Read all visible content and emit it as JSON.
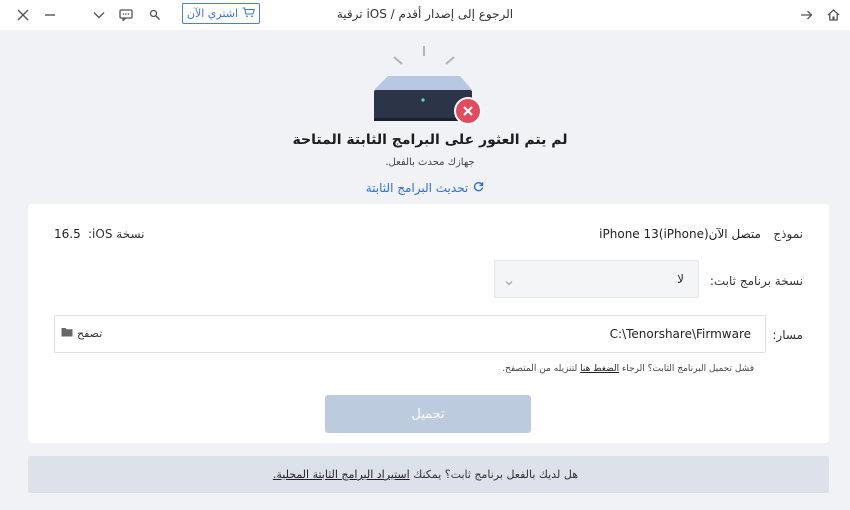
{
  "titlebar": {
    "title": "ترقية iOS / الرجوع إلى إصدار أقدم",
    "buy_label": "اشتري الآن"
  },
  "status": {
    "title": "لم يتم العثور على البرامج الثابتة المتاحة",
    "subtitle": "جهازك محدث بالفعل.",
    "refresh_label": "تحديث البرامج الثابتة"
  },
  "device_info": {
    "model_label": "نموذج",
    "model_value": "iPhone 13(iPhone)متصل الآن",
    "ios_label": "نسخة iOS:",
    "ios_value": "16.5"
  },
  "firmware_version": {
    "label": "نسخة برنامج ثابت:",
    "selected": "لا"
  },
  "path": {
    "label": "مسار:",
    "value": "C:\\Tenorshare\\Firmware",
    "browse_label": "تصفح"
  },
  "hint": {
    "prefix": "فشل تحميل البرنامج الثابت؟ الرجاء",
    "link": "الضغط هنا",
    "suffix": "لتنزيله من المتصفح."
  },
  "download_label": "تحميل",
  "footer": {
    "prefix": "هل لديك بالفعل برنامج ثابت؟ يمكنك",
    "link": "استيراد البرامج الثابتة المحلية."
  },
  "colors": {
    "accent": "#3f77d3",
    "error": "#e34a5e",
    "download_disabled": "#bccbde",
    "footer_bg": "#dde2ea"
  },
  "icons": [
    "close-icon",
    "minimize-icon",
    "chevron-down-icon",
    "feedback-icon",
    "search-icon",
    "cart-icon",
    "arrow-right-icon",
    "home-icon",
    "refresh-icon",
    "folder-icon",
    "error-icon"
  ]
}
